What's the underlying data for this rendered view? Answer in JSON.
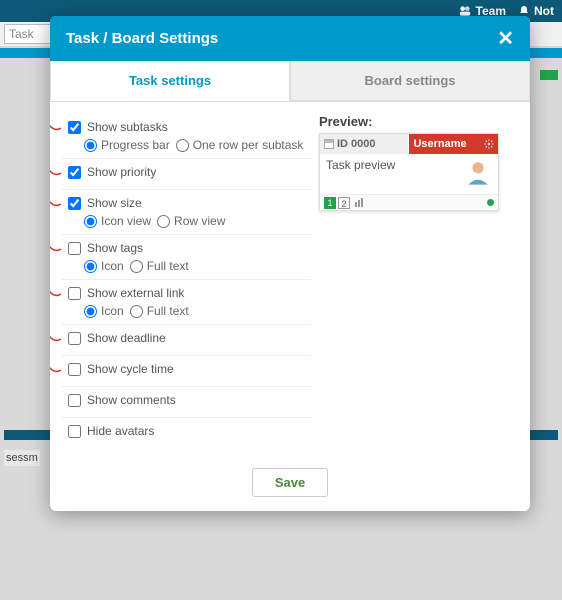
{
  "topbar": {
    "team": "Team",
    "notif": "Not"
  },
  "search_placeholder": "Task",
  "backdrop_label": "sessm",
  "modal": {
    "title": "Task / Board Settings",
    "tab_task": "Task settings",
    "tab_board": "Board settings"
  },
  "settings": {
    "subtasks": {
      "label": "Show subtasks",
      "opt1": "Progress bar",
      "opt2": "One row per subtask"
    },
    "priority": {
      "label": "Show priority"
    },
    "size": {
      "label": "Show size",
      "opt1": "Icon view",
      "opt2": "Row view"
    },
    "tags": {
      "label": "Show tags",
      "opt1": "Icon",
      "opt2": "Full text"
    },
    "extlink": {
      "label": "Show external link",
      "opt1": "Icon",
      "opt2": "Full text"
    },
    "deadline": {
      "label": "Show deadline"
    },
    "cycle": {
      "label": "Show cycle time"
    },
    "comments": {
      "label": "Show comments"
    },
    "avatars": {
      "label": "Hide avatars"
    }
  },
  "preview": {
    "label": "Preview:",
    "id": "ID 0000",
    "username": "Username",
    "body": "Task preview",
    "size1": "1",
    "size2": "2"
  },
  "save": "Save"
}
